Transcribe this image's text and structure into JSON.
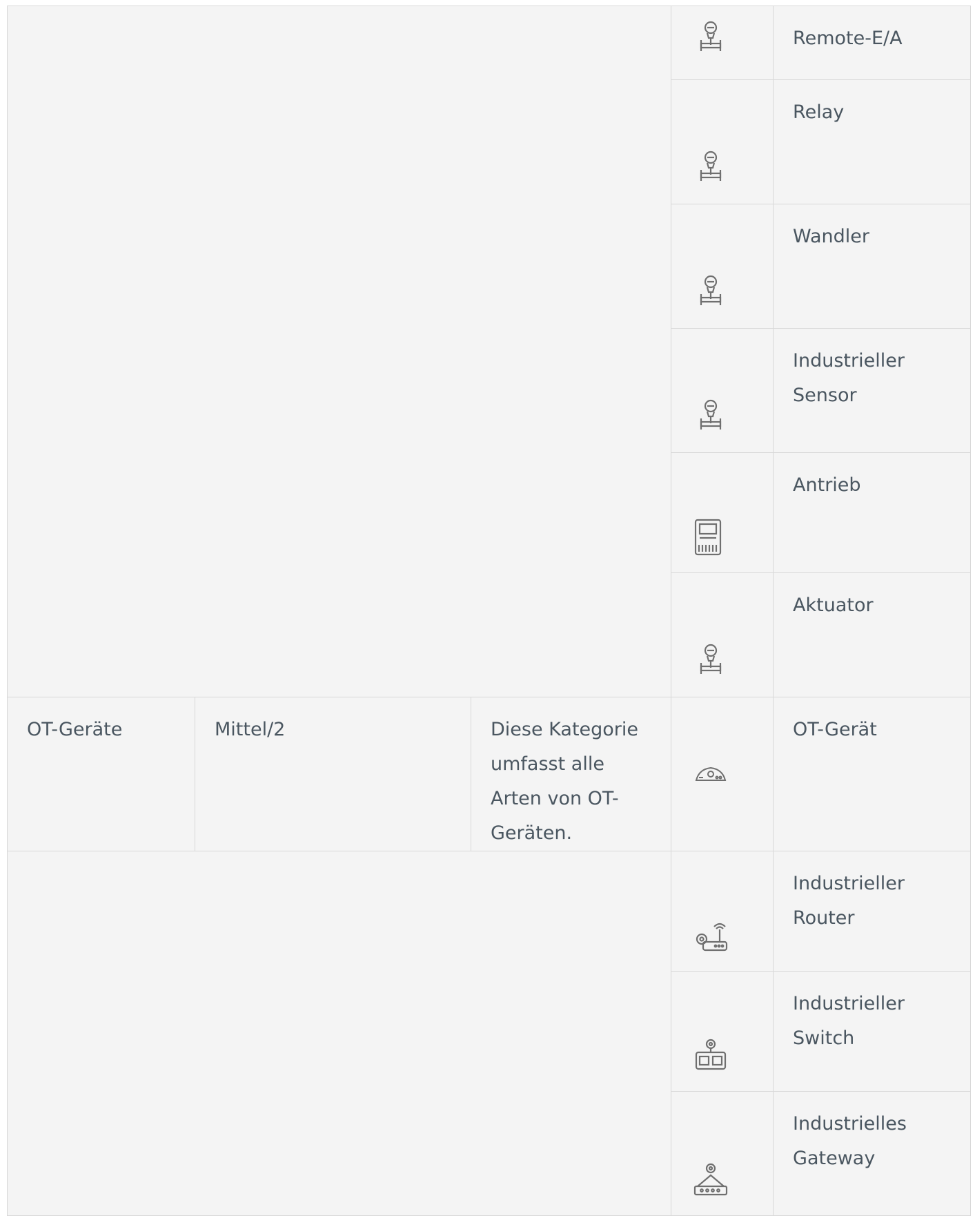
{
  "rows_top": [
    {
      "icon": "sensor-icon",
      "name": "Remote-E/A"
    },
    {
      "icon": "sensor-icon",
      "name": "Relay"
    },
    {
      "icon": "sensor-icon",
      "name": "Wandler"
    },
    {
      "icon": "sensor-icon",
      "name": "Industrieller Sensor"
    },
    {
      "icon": "drive-icon",
      "name": "Antrieb"
    },
    {
      "icon": "sensor-icon",
      "name": "Aktuator"
    }
  ],
  "ot_row": {
    "category": "OT-Geräte",
    "level": "Mittel/2",
    "description": "Diese Kategorie umfasst alle Arten von OT-Geräten.",
    "icon": "ot-device-icon",
    "name": "OT-Gerät"
  },
  "rows_bottom": [
    {
      "icon": "industrial-router-icon",
      "name": "Industrieller Router"
    },
    {
      "icon": "industrial-switch-icon",
      "name": "Industrieller Switch"
    },
    {
      "icon": "industrial-gateway-icon",
      "name": "Industrielles Gateway"
    }
  ],
  "colors": {
    "background": "#f4f4f4",
    "border": "#d8d8d8",
    "text": "#4a5660",
    "icon": "#6f6f6f"
  }
}
